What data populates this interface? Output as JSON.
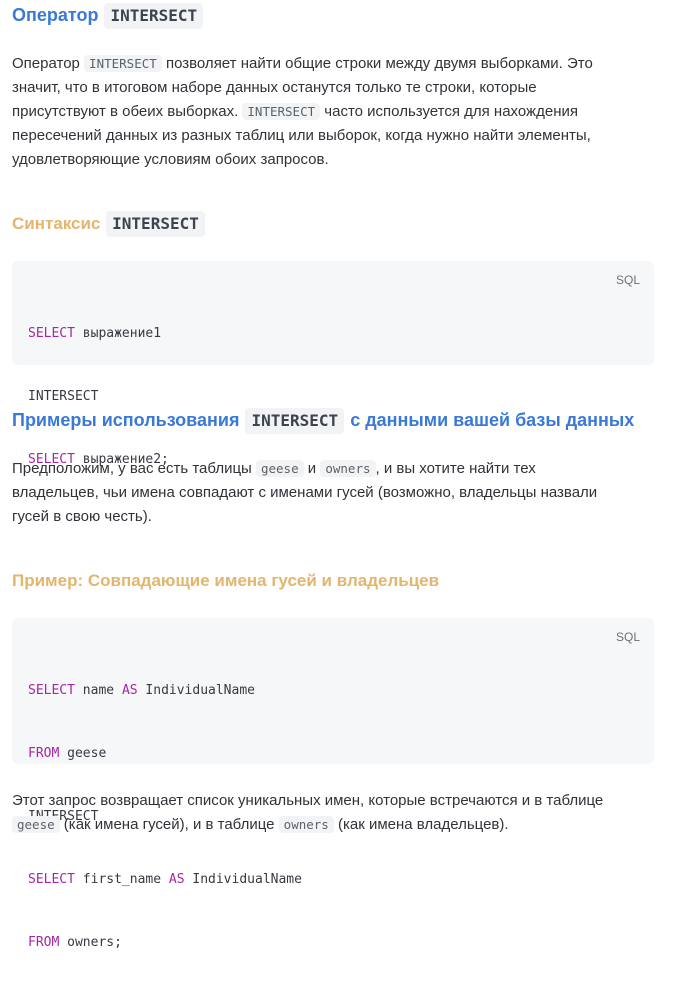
{
  "section_intro": {
    "title_text": "Оператор",
    "title_code": "INTERSECT",
    "paragraph": {
      "l1_a": "Оператор ",
      "l1_code": "INTERSECT",
      "l1_b": " позволяет найти общие строки между двумя выборками. Это",
      "l2": "значит, что в итоговом наборе данных останутся только те строки, которые",
      "l3_a": "присутствуют в обеих выборках. ",
      "l3_code": "INTERSECT",
      "l3_b": " часто используется для нахождения",
      "l4": "пересечений данных из разных таблиц или выборок, когда нужно найти элементы,",
      "l5": "удовлетворяющие условиям обоих запросов."
    }
  },
  "section_syntax": {
    "title_text": "Синтаксис",
    "title_code": "INTERSECT",
    "code_lang": "SQL",
    "code": {
      "l1_kw": "SELECT",
      "l1_rest": " выражение1",
      "l2": "INTERSECT",
      "l3_kw": "SELECT",
      "l3_rest": " выражение2;"
    }
  },
  "section_examples": {
    "title_a": "Примеры использования",
    "title_code": "INTERSECT",
    "title_b": "с данными вашей базы данных",
    "paragraph": {
      "l1_a": "Предположим, у вас есть таблицы ",
      "l1_code1": "geese",
      "l1_mid": " и ",
      "l1_code2": "owners",
      "l1_b": ", и вы хотите найти тех",
      "l2": "владельцев, чьи имена совпадают с именами гусей (возможно, владельцы назвали",
      "l3": "гусей в свою честь)."
    }
  },
  "section_example1": {
    "title": "Пример: Совпадающие имена гусей и владельцев",
    "code_lang": "SQL",
    "code": {
      "l1_kw": "SELECT",
      "l1_mid": " name ",
      "l1_kw2": "AS",
      "l1_rest": " IndividualName",
      "l2_kw": "FROM",
      "l2_rest": " geese",
      "l3": "INTERSECT",
      "l4_kw": "SELECT",
      "l4_mid": " first_name ",
      "l4_kw2": "AS",
      "l4_rest": " IndividualName",
      "l5_kw": "FROM",
      "l5_rest": " owners;"
    },
    "paragraph": {
      "l1": "Этот запрос возвращает список уникальных имен, которые встречаются и в таблице",
      "l2_code1": "geese",
      "l2_a": " (как имена гусей), и в таблице ",
      "l2_code2": "owners",
      "l2_b": " (как имена владельцев)."
    }
  },
  "colors": {
    "h2": "#3a79d6",
    "h3": "#e3b56d",
    "keyword": "#a626a4",
    "code_bg": "#f6f7f9"
  }
}
